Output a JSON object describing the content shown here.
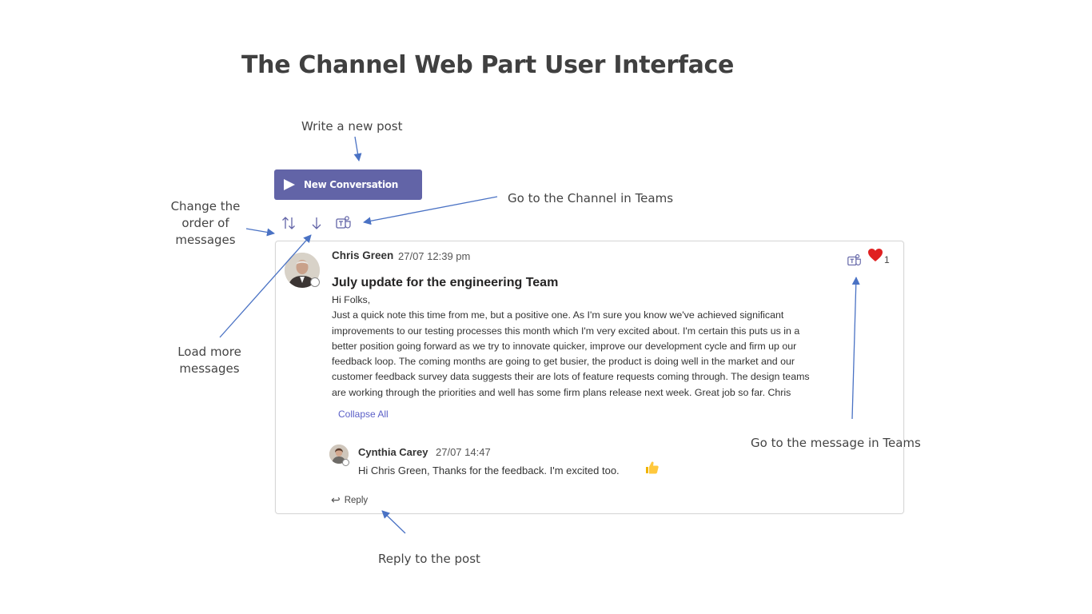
{
  "page": {
    "title": "The Channel Web Part User Interface"
  },
  "callouts": {
    "write_post": "Write a new post",
    "change_order": [
      "Change the",
      "order of",
      "messages"
    ],
    "load_more": [
      "Load more",
      "messages"
    ],
    "go_channel": "Go to the Channel in Teams",
    "go_message": "Go to the message in Teams",
    "reply_post": "Reply to the post"
  },
  "toolbar": {
    "new_conversation_label": "New Conversation",
    "icons": [
      "sort-order-icon",
      "load-more-arrow-icon",
      "teams-channel-icon"
    ]
  },
  "post": {
    "author": "Chris Green",
    "timestamp": "27/07 12:39 pm",
    "title": "July update for the engineering Team",
    "body_lines": [
      "Hi Folks,",
      "Just a quick note this time from me, but a positive one. As I'm sure you know we've achieved significant",
      "improvements to our testing processes this month which I'm very excited about. I'm certain this puts us in a",
      "better position going forward as we try to innovate quicker, improve our development cycle and firm up our",
      "feedback loop. The coming months are going to get busier, the product is doing well in the market and our",
      "customer feedback survey data suggests their are lots of feature requests coming through. The design teams",
      "are working through the priorities and well has some firm plans release next week. Great job so far. Chris"
    ],
    "collapse_label": "Collapse All",
    "reactions": {
      "icon": "heart-icon",
      "count": "1"
    }
  },
  "reply": {
    "author": "Cynthia Carey",
    "timestamp": "27/07 14:47",
    "text": "Hi Chris Green, Thanks for the feedback. I'm excited too.",
    "emoji_icon": "thumbs-up-icon",
    "reply_label": "Reply"
  },
  "colors": {
    "accent": "#6264a7",
    "arrow": "#4a72c4",
    "heart": "#e02020",
    "link": "#5b5fc7"
  }
}
